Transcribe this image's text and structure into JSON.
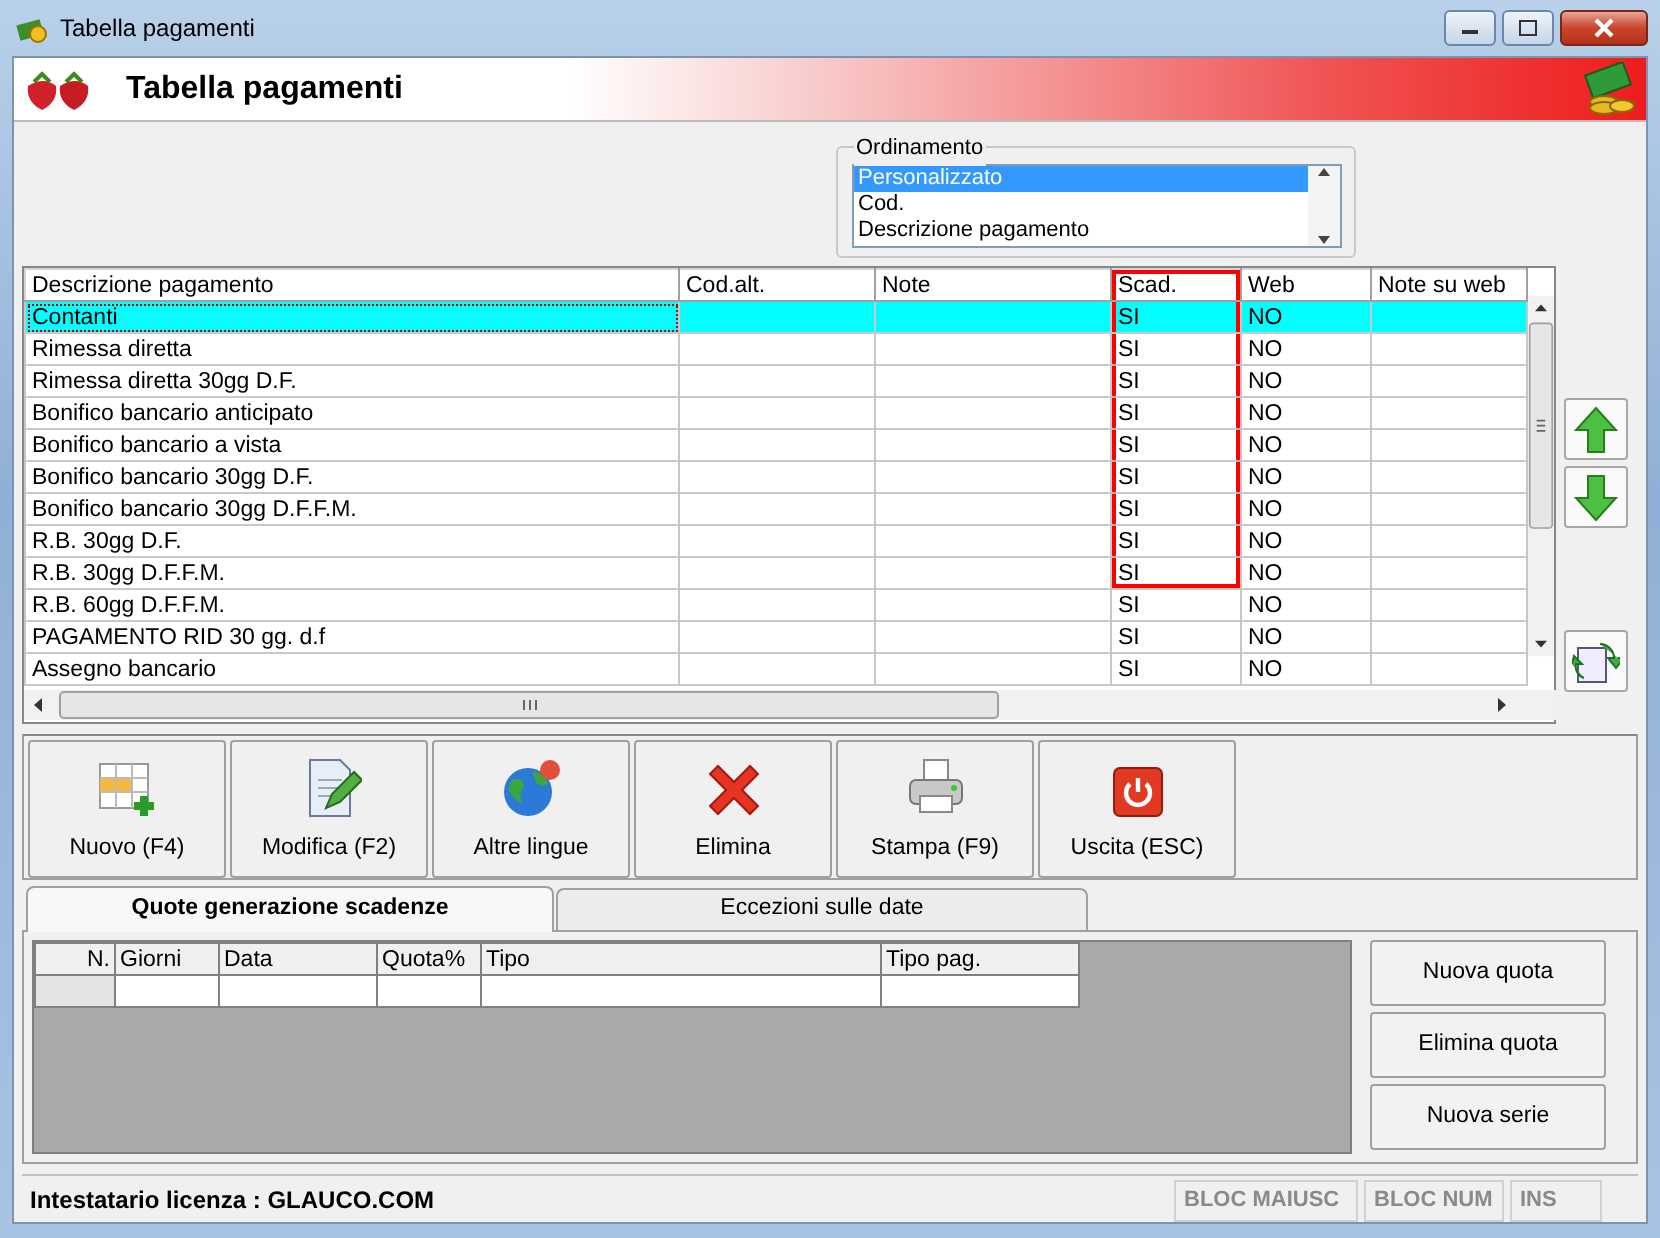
{
  "window": {
    "title": "Tabella pagamenti"
  },
  "header": {
    "title": "Tabella pagamenti"
  },
  "ordering": {
    "label": "Ordinamento",
    "options": [
      {
        "label": "Personalizzato",
        "selected": true
      },
      {
        "label": "Cod.",
        "selected": false
      },
      {
        "label": "Descrizione pagamento",
        "selected": false
      }
    ]
  },
  "table": {
    "columns": [
      {
        "label": "Descrizione pagamento",
        "highlighted": false
      },
      {
        "label": "Cod.alt.",
        "highlighted": false
      },
      {
        "label": "Note",
        "highlighted": false
      },
      {
        "label": "Scad.",
        "highlighted": true
      },
      {
        "label": "Web",
        "highlighted": false
      },
      {
        "label": "Note su web",
        "highlighted": false
      }
    ],
    "rows": [
      {
        "description": "Contanti",
        "scad": "SI",
        "web": "NO",
        "selected": true,
        "highlighted": true
      },
      {
        "description": "Rimessa diretta",
        "scad": "SI",
        "web": "NO",
        "selected": false,
        "highlighted": true
      },
      {
        "description": "Rimessa diretta 30gg D.F.",
        "scad": "SI",
        "web": "NO",
        "selected": false,
        "highlighted": true
      },
      {
        "description": "Bonifico bancario anticipato",
        "scad": "SI",
        "web": "NO",
        "selected": false,
        "highlighted": true
      },
      {
        "description": "Bonifico bancario a vista",
        "scad": "SI",
        "web": "NO",
        "selected": false,
        "highlighted": true
      },
      {
        "description": "Bonifico bancario 30gg D.F.",
        "scad": "SI",
        "web": "NO",
        "selected": false,
        "highlighted": true
      },
      {
        "description": "Bonifico bancario 30gg D.F.F.M.",
        "scad": "SI",
        "web": "NO",
        "selected": false,
        "highlighted": true
      },
      {
        "description": "R.B. 30gg D.F.",
        "scad": "SI",
        "web": "NO",
        "selected": false,
        "highlighted": true
      },
      {
        "description": "R.B. 30gg D.F.F.M.",
        "scad": "SI",
        "web": "NO",
        "selected": false,
        "highlighted": true
      },
      {
        "description": "R.B. 60gg D.F.F.M.",
        "scad": "SI",
        "web": "NO",
        "selected": false,
        "highlighted": false
      },
      {
        "description": "PAGAMENTO RID 30 gg. d.f",
        "scad": "SI",
        "web": "NO",
        "selected": false,
        "highlighted": false
      },
      {
        "description": "Assegno bancario",
        "scad": "SI",
        "web": "NO",
        "selected": false,
        "highlighted": false
      }
    ]
  },
  "toolbar": [
    "Nuovo (F4)",
    "Modifica (F2)",
    "Altre lingue",
    "Elimina",
    "Stampa (F9)",
    "Uscita (ESC)"
  ],
  "tabs": [
    {
      "label": "Quote generazione scadenze",
      "selected": true
    },
    {
      "label": "Eccezioni sulle date",
      "selected": false
    }
  ],
  "quote_table": {
    "columns": [
      "N.",
      "Giorni",
      "Data",
      "Quota%",
      "Tipo",
      "Tipo pag."
    ]
  },
  "quote_buttons": [
    "Nuova quota",
    "Elimina quota",
    "Nuova serie"
  ],
  "status_bar": {
    "license": "Intestatario licenza : GLAUCO.COM",
    "indicators": [
      {
        "label": "BLOC MAIUSC",
        "active": false
      },
      {
        "label": "BLOC NUM",
        "active": false
      },
      {
        "label": "INS",
        "active": false
      }
    ]
  }
}
